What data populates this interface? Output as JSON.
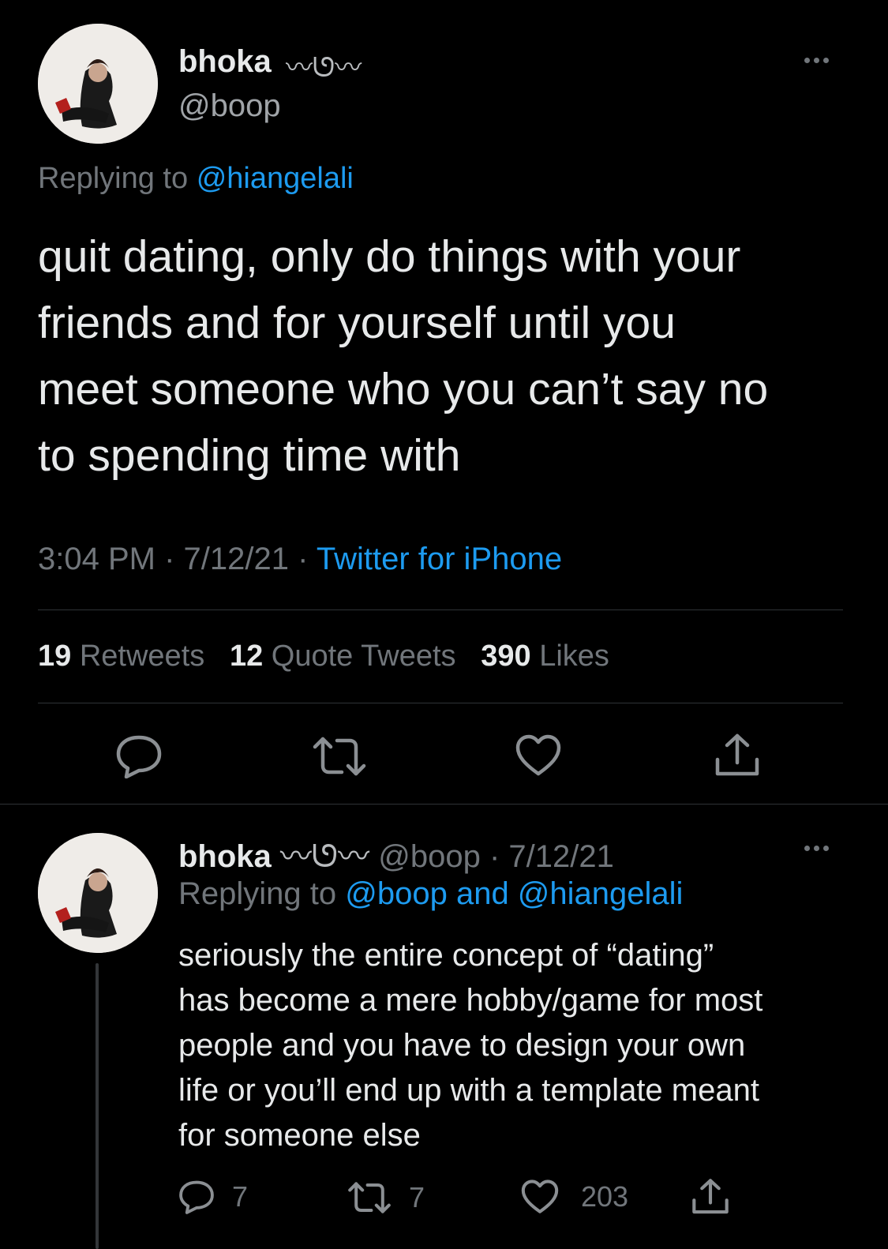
{
  "main_tweet": {
    "display_name": "bhoka",
    "name_decoration": "〰ᘎ〰",
    "handle": "@boop",
    "replying_prefix": "Replying to",
    "replying_to": "@hiangelali",
    "text_lines": [
      "quit dating, only do things with your",
      "friends and for yourself until you",
      "meet someone who you can’t say no",
      "to spending time with"
    ],
    "time": "3:04 PM",
    "sep": "·",
    "date": "7/12/21",
    "source": "Twitter for iPhone",
    "stats": {
      "retweets_count": "19",
      "retweets_label": "Retweets",
      "quotes_count": "12",
      "quotes_label": "Quote Tweets",
      "likes_count": "390",
      "likes_label": "Likes"
    }
  },
  "reply_tweet": {
    "display_name": "bhoka",
    "name_decoration": "〰ᘎ〰",
    "handle_date": "@boop · 7/12/21",
    "replying_prefix": "Replying to",
    "replying_to": "@boop and @hiangelali",
    "text_lines": [
      "seriously the entire concept of “dating”",
      "has become a mere hobby/game for most",
      "people and you have to design your own",
      "life or you’ll end up with a template meant",
      "for someone else"
    ],
    "reply_count": "7",
    "retweet_count": "7",
    "like_count": "203"
  },
  "colors": {
    "background": "#000000",
    "text": "#e7e9ea",
    "muted": "#71767b",
    "link": "#1d9bf0",
    "divider": "#2f3336"
  }
}
